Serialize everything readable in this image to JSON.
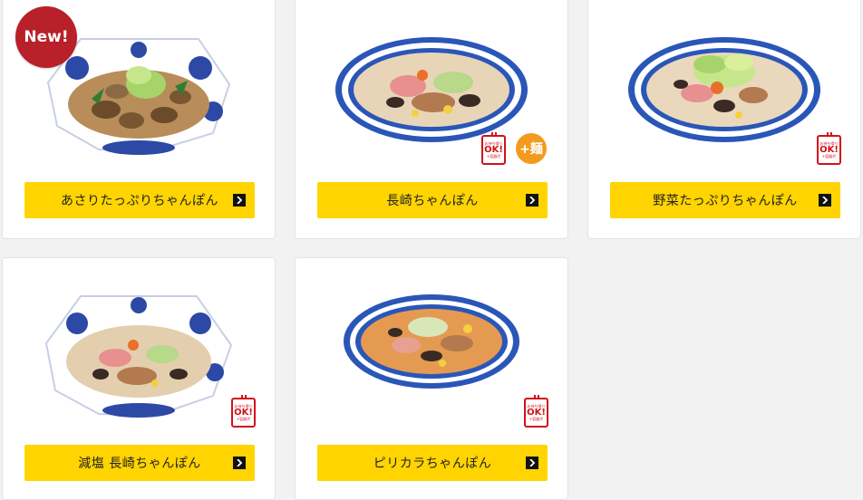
{
  "badges": {
    "new": "New!",
    "takeout_line1": "お持ち帰り",
    "takeout_line2": "OK!",
    "takeout_line3": "+容器代",
    "extra_noodle": "+麺"
  },
  "menu": {
    "items": [
      {
        "name": "あさりたっぷりちゃんぽん"
      },
      {
        "name": "長崎ちゃんぽん"
      },
      {
        "name": "野菜たっぷりちゃんぽん"
      },
      {
        "name": "減塩 長崎ちゃんぽん"
      },
      {
        "name": "ピリカラちゃんぽん"
      }
    ]
  },
  "colors": {
    "button": "#ffd400",
    "new_badge": "#b8202a",
    "bowl_rim_blue": "#2a56b8",
    "noodle_badge": "#f39b1d"
  }
}
